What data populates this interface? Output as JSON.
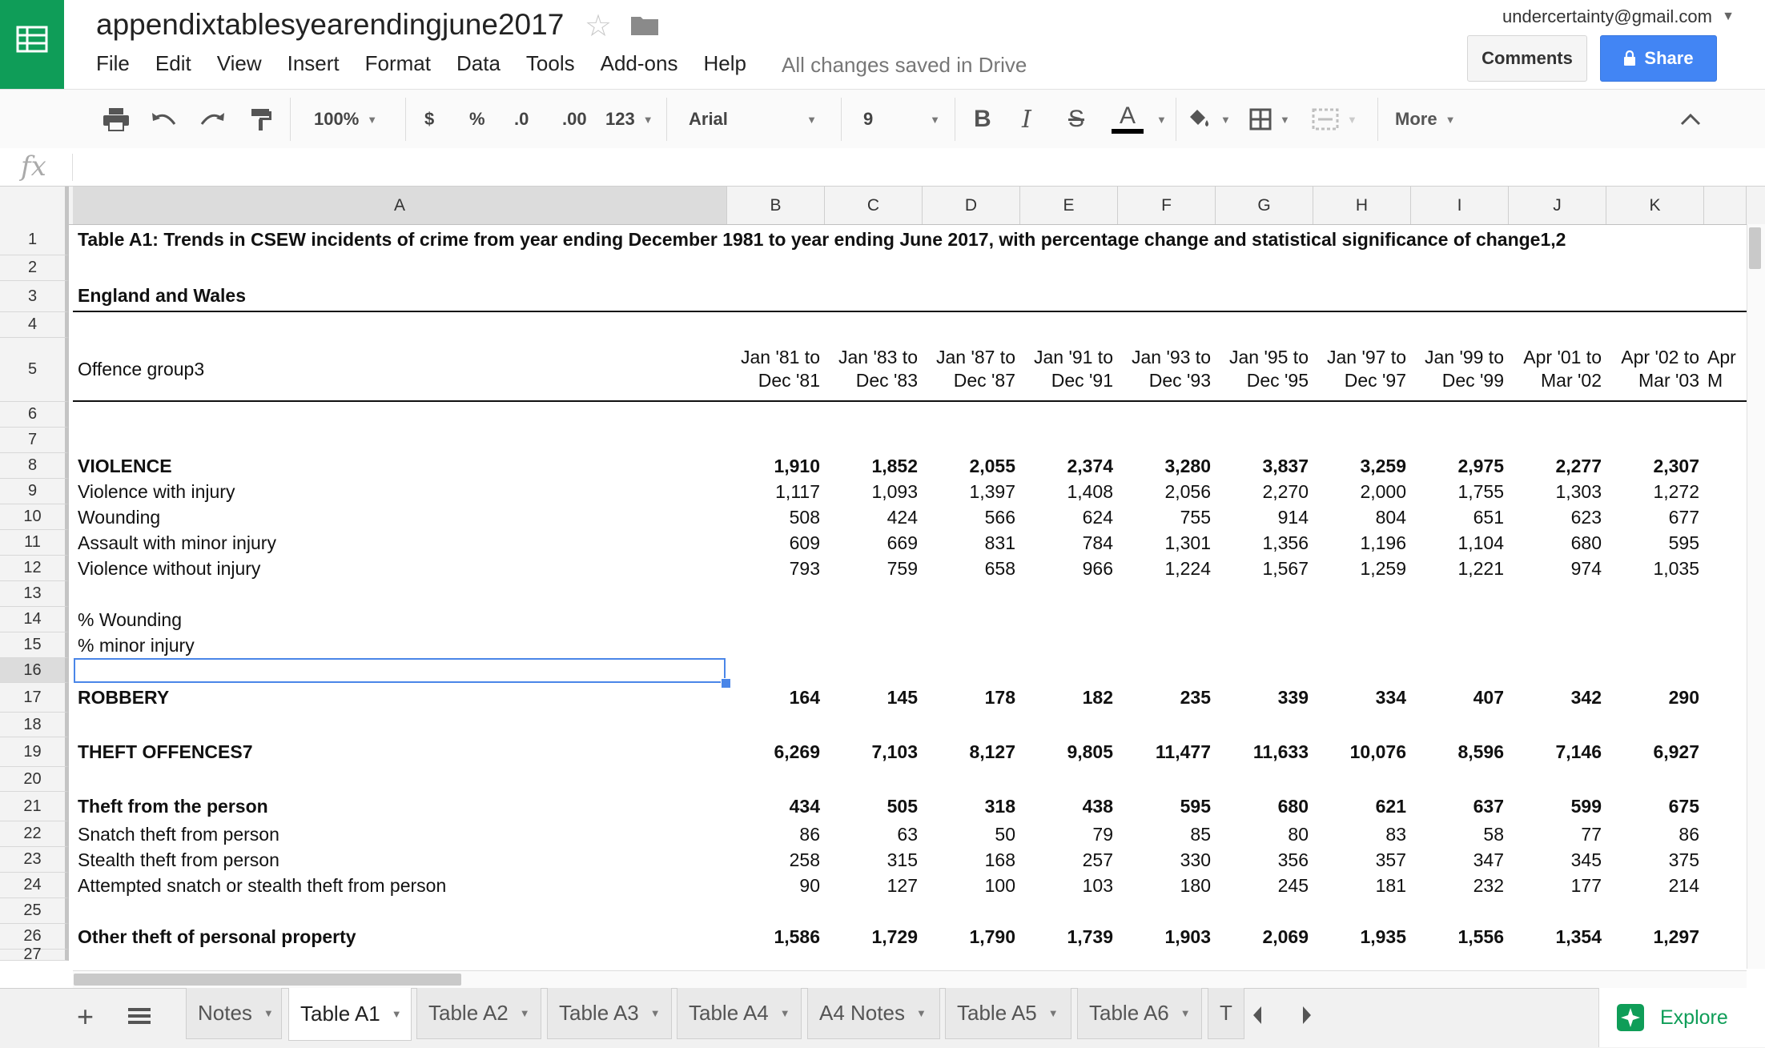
{
  "header": {
    "doc_title": "appendixtablesyearendingjune2017",
    "account_email": "undercertainty@gmail.com",
    "saved_status": "All changes saved in Drive",
    "comments_label": "Comments",
    "share_label": "Share",
    "brand_color": "#0f9d58",
    "share_color": "#4285f4"
  },
  "menu": [
    "File",
    "Edit",
    "View",
    "Insert",
    "Format",
    "Data",
    "Tools",
    "Add-ons",
    "Help"
  ],
  "toolbar": {
    "zoom": "100%",
    "currency": "$",
    "percent": "%",
    "decrease_decimals": ".0",
    "increase_decimals": ".00",
    "more_formats": "123",
    "font": "Arial",
    "font_size": "9",
    "bold": "B",
    "italic": "I",
    "strike": "S",
    "text_color": "A",
    "more": "More"
  },
  "formula_bar": {
    "fx_label": "fx",
    "value": ""
  },
  "columns": [
    "A",
    "B",
    "C",
    "D",
    "E",
    "F",
    "G",
    "H",
    "I",
    "J",
    "K"
  ],
  "selected_cell": "A16",
  "rows": [
    {
      "n": "1",
      "label": "Table A1: Trends in CSEW incidents of crime from year ending December 1981 to year ending June 2017, with percentage change and statistical significance of change1,2",
      "bold": true
    },
    {
      "n": "2",
      "label": ""
    },
    {
      "n": "3",
      "label": "England and Wales",
      "bold": true
    },
    {
      "n": "4",
      "label": ""
    },
    {
      "n": "5",
      "label": "Offence group3",
      "header": true,
      "periods": [
        [
          "Jan '81 to",
          "Dec '81"
        ],
        [
          "Jan '83 to",
          "Dec '83"
        ],
        [
          "Jan '87 to",
          "Dec '87"
        ],
        [
          "Jan '91 to",
          "Dec '91"
        ],
        [
          "Jan '93 to",
          "Dec '93"
        ],
        [
          "Jan '95 to",
          "Dec '95"
        ],
        [
          "Jan '97 to",
          "Dec '97"
        ],
        [
          "Jan '99 to",
          "Dec '99"
        ],
        [
          "Apr '01 to",
          "Mar '02"
        ],
        [
          "Apr '02 to",
          "Mar '03"
        ],
        [
          "Apr",
          "M"
        ]
      ]
    },
    {
      "n": "6",
      "label": ""
    },
    {
      "n": "7",
      "label": ""
    },
    {
      "n": "8",
      "label": "VIOLENCE",
      "bold": true,
      "values": [
        "1,910",
        "1,852",
        "2,055",
        "2,374",
        "3,280",
        "3,837",
        "3,259",
        "2,975",
        "2,277",
        "2,307"
      ]
    },
    {
      "n": "9",
      "label": "Violence with injury",
      "values": [
        "1,117",
        "1,093",
        "1,397",
        "1,408",
        "2,056",
        "2,270",
        "2,000",
        "1,755",
        "1,303",
        "1,272"
      ]
    },
    {
      "n": "10",
      "label": "Wounding",
      "values": [
        "508",
        "424",
        "566",
        "624",
        "755",
        "914",
        "804",
        "651",
        "623",
        "677"
      ]
    },
    {
      "n": "11",
      "label": "Assault with minor injury",
      "values": [
        "609",
        "669",
        "831",
        "784",
        "1,301",
        "1,356",
        "1,196",
        "1,104",
        "680",
        "595"
      ]
    },
    {
      "n": "12",
      "label": "Violence without injury",
      "values": [
        "793",
        "759",
        "658",
        "966",
        "1,224",
        "1,567",
        "1,259",
        "1,221",
        "974",
        "1,035"
      ]
    },
    {
      "n": "13",
      "label": ""
    },
    {
      "n": "14",
      "label": "% Wounding"
    },
    {
      "n": "15",
      "label": "% minor injury"
    },
    {
      "n": "16",
      "label": ""
    },
    {
      "n": "17",
      "label": "ROBBERY",
      "bold": true,
      "values": [
        "164",
        "145",
        "178",
        "182",
        "235",
        "339",
        "334",
        "407",
        "342",
        "290"
      ]
    },
    {
      "n": "18",
      "label": ""
    },
    {
      "n": "19",
      "label": "THEFT OFFENCES7",
      "bold": true,
      "values": [
        "6,269",
        "7,103",
        "8,127",
        "9,805",
        "11,477",
        "11,633",
        "10,076",
        "8,596",
        "7,146",
        "6,927"
      ]
    },
    {
      "n": "20",
      "label": ""
    },
    {
      "n": "21",
      "label": "Theft from the person",
      "bold": true,
      "values": [
        "434",
        "505",
        "318",
        "438",
        "595",
        "680",
        "621",
        "637",
        "599",
        "675"
      ]
    },
    {
      "n": "22",
      "label": "Snatch theft from person",
      "values": [
        "86",
        "63",
        "50",
        "79",
        "85",
        "80",
        "83",
        "58",
        "77",
        "86"
      ]
    },
    {
      "n": "23",
      "label": "Stealth theft from person",
      "values": [
        "258",
        "315",
        "168",
        "257",
        "330",
        "356",
        "357",
        "347",
        "345",
        "375"
      ]
    },
    {
      "n": "24",
      "label": "Attempted snatch or stealth theft from person",
      "values": [
        "90",
        "127",
        "100",
        "103",
        "180",
        "245",
        "181",
        "232",
        "177",
        "214"
      ]
    },
    {
      "n": "25",
      "label": ""
    },
    {
      "n": "26",
      "label": "Other theft of personal property",
      "bold": true,
      "values": [
        "1,586",
        "1,729",
        "1,790",
        "1,739",
        "1,903",
        "2,069",
        "1,935",
        "1,556",
        "1,354",
        "1,297"
      ]
    },
    {
      "n": "27",
      "label": ""
    }
  ],
  "sheet_tabs": [
    {
      "label": "Notes"
    },
    {
      "label": "Table A1",
      "active": true
    },
    {
      "label": "Table A2"
    },
    {
      "label": "Table A3"
    },
    {
      "label": "Table A4"
    },
    {
      "label": "A4 Notes"
    },
    {
      "label": "Table A5"
    },
    {
      "label": "Table A6"
    },
    {
      "label": "T"
    }
  ],
  "explore_label": "Explore"
}
